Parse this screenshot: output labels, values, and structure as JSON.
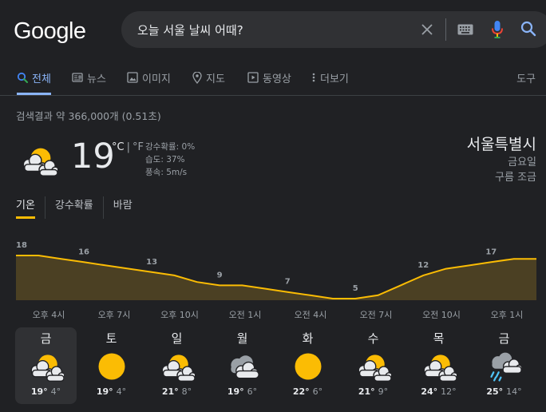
{
  "search": {
    "query": "오늘 서울 날씨 어때?"
  },
  "tabs": [
    {
      "label": "전체",
      "icon": "search-icon"
    },
    {
      "label": "뉴스",
      "icon": "news-icon"
    },
    {
      "label": "이미지",
      "icon": "image-icon"
    },
    {
      "label": "지도",
      "icon": "map-pin-icon"
    },
    {
      "label": "동영상",
      "icon": "video-icon"
    },
    {
      "label": "더보기",
      "icon": "more-icon"
    }
  ],
  "tools_label": "도구",
  "stats": "검색결과 약 366,000개 (0.51초)",
  "weather": {
    "temp": "19",
    "unit_c": "°C",
    "unit_sep": "|",
    "unit_f": "°F",
    "precip": "강수확률: 0%",
    "humidity": "습도: 37%",
    "wind": "풍속: 5m/s",
    "location": "서울특별시",
    "day": "금요일",
    "condition": "구름 조금",
    "condition_icon": "partly-cloudy-icon"
  },
  "weather_tabs": [
    "기온",
    "강수확률",
    "바람"
  ],
  "colors": {
    "accent": "#8ab4f8",
    "sun": "#fbbc04",
    "chart_fill": "#4b4023",
    "background": "#202124"
  },
  "chart_data": {
    "type": "area",
    "x": [
      "오후 4시",
      "",
      "",
      "오후 7시",
      "",
      "",
      "오후 10시",
      "",
      "",
      "오전 1시",
      "",
      "",
      "오전 4시",
      "",
      "",
      "오전 7시",
      "",
      "",
      "오전 10시",
      "",
      "",
      "오후 1시",
      "",
      ""
    ],
    "values": [
      18,
      18,
      17,
      16,
      15,
      14,
      13,
      12,
      10,
      9,
      9,
      8,
      7,
      6,
      5,
      5,
      6,
      9,
      12,
      14,
      15,
      16,
      17,
      17
    ],
    "labels": [
      {
        "index": 0,
        "text": "18"
      },
      {
        "index": 3,
        "text": "16"
      },
      {
        "index": 6,
        "text": "13"
      },
      {
        "index": 9,
        "text": "9"
      },
      {
        "index": 12,
        "text": "7"
      },
      {
        "index": 15,
        "text": "5"
      },
      {
        "index": 18,
        "text": "12"
      },
      {
        "index": 21,
        "text": "17"
      }
    ],
    "ticks": [
      "오후 4시",
      "오후 7시",
      "오후 10시",
      "오전 1시",
      "오전 4시",
      "오전 7시",
      "오전 10시",
      "오후 1시"
    ],
    "ylim": [
      0,
      22
    ]
  },
  "forecast": [
    {
      "day": "금",
      "hi": "19°",
      "lo": "4°",
      "icon": "partly-cloudy-icon"
    },
    {
      "day": "토",
      "hi": "19°",
      "lo": "4°",
      "icon": "sunny-icon"
    },
    {
      "day": "일",
      "hi": "21°",
      "lo": "8°",
      "icon": "partly-cloudy-icon"
    },
    {
      "day": "월",
      "hi": "19°",
      "lo": "6°",
      "icon": "cloudy-icon"
    },
    {
      "day": "화",
      "hi": "22°",
      "lo": "6°",
      "icon": "sunny-icon"
    },
    {
      "day": "수",
      "hi": "21°",
      "lo": "9°",
      "icon": "partly-cloudy-icon"
    },
    {
      "day": "목",
      "hi": "24°",
      "lo": "12°",
      "icon": "partly-cloudy-icon"
    },
    {
      "day": "금",
      "hi": "25°",
      "lo": "14°",
      "icon": "rain-icon"
    }
  ]
}
